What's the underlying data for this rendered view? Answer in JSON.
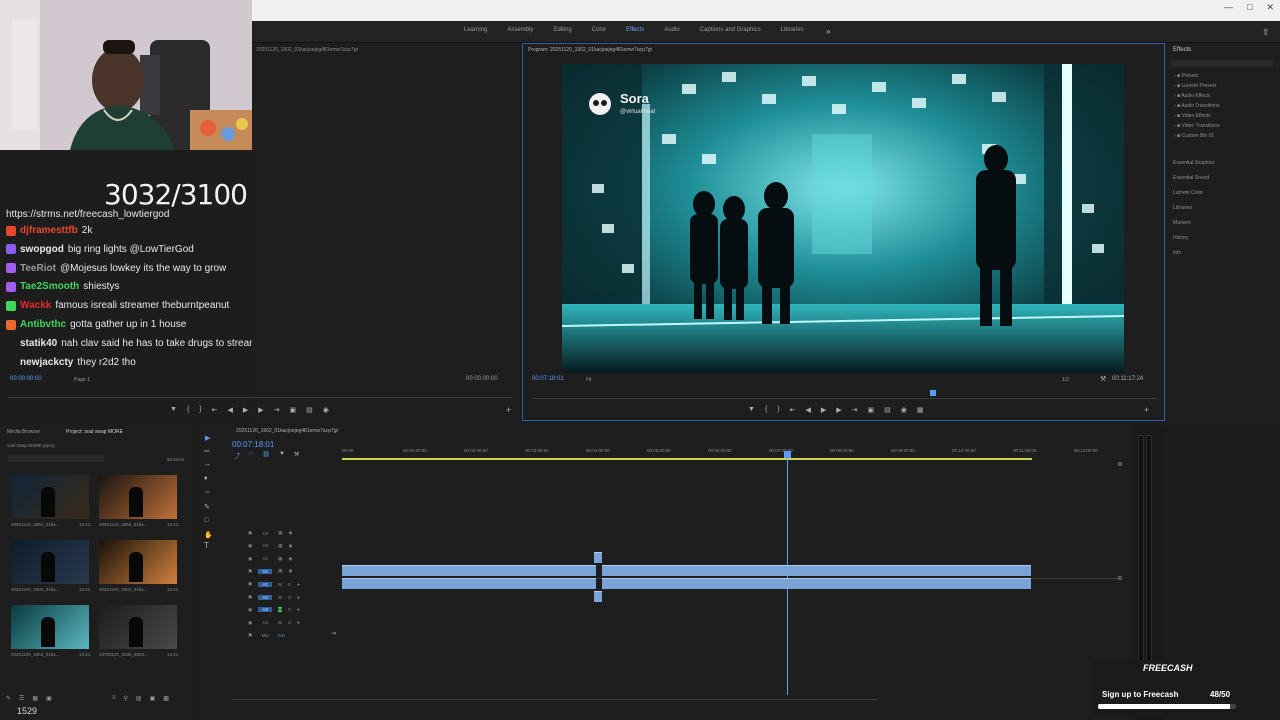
{
  "workspace_tabs": [
    "Learning",
    "Assembly",
    "Editing",
    "Color",
    "Effects",
    "Audio",
    "Captions and Graphics",
    "Libraries"
  ],
  "active_tab": "Effects",
  "stream": {
    "counter": "3032/3100",
    "link": "https://strms.net/freecash_lowtiergod",
    "chat": [
      {
        "user": "djframesttfb",
        "message": "2k",
        "color": "#e8472b"
      },
      {
        "user": "swopgod",
        "message": "big ring lights @LowTierGod",
        "color": "#e8e8e8"
      },
      {
        "user": "TeeRiot",
        "message": "@Mojesus lowkey its the way to grow",
        "color": "#9a9a9a"
      },
      {
        "user": "Tae2Smooth",
        "message": "shiestys",
        "color": "#3fd65c"
      },
      {
        "user": "Wackk",
        "message": "famous isreali streamer theburntpeanut",
        "color": "#e8272b"
      },
      {
        "user": "Antibvthc",
        "message": "gotta gather up in 1 house",
        "color": "#3fd65c"
      },
      {
        "user": "statik40",
        "message": "nah clav said he has to take drugs to stream",
        "color": "#e8e8e8"
      },
      {
        "user": "newjackcty",
        "message": "they r2d2 tho",
        "color": "#e8e8e8"
      }
    ],
    "viewer_count": "1529"
  },
  "source_monitor": {
    "title": "20251120_1902_01kacjoejeg481emw7acp7gt",
    "timecode_left": "00:00:00:00",
    "page": "Page 1",
    "timecode_right": "00:00:00:00"
  },
  "program_monitor": {
    "title": "Program: 20251120_1902_01kacjoejeg481emw7acp7gt",
    "timecode": "00:07:18:01",
    "fit": "Fit",
    "resolution": "1/2",
    "duration": "00:11:17:24",
    "watermark": "Sora",
    "watermark_handle": "@virtualmeal"
  },
  "effects_panel": {
    "title": "Effects",
    "tree": [
      "Presets",
      "Lumetri Presets",
      "Audio Effects",
      "Audio Transitions",
      "Video Effects",
      "Video Transitions",
      "Custom Bin 01"
    ],
    "sections": [
      "Essential Graphics",
      "Essential Sound",
      "Lumetri Color",
      "Libraries",
      "Markers",
      "History",
      "Info"
    ]
  },
  "project_panel": {
    "tabs": [
      "Media Browser",
      "Project: soul swap MORE"
    ],
    "path": "soul swap MORE.prproj",
    "item_count": "50 items",
    "thumbs": [
      {
        "name": "20251120_1854_01ka...",
        "duration": "14:21"
      },
      {
        "name": "20251120_1856_01ka...",
        "duration": "14:21"
      },
      {
        "name": "20251120_1900_01ka...",
        "duration": "14:21"
      },
      {
        "name": "20251120_1902_01ka...",
        "duration": "14:21"
      },
      {
        "name": "20251120_1954_01ka...",
        "duration": "14:21"
      },
      {
        "name": "19700121_0335_6920...",
        "duration": "14:21"
      }
    ]
  },
  "timeline": {
    "title": "20251120_1902_01kacjoejeg481emw7acp7gt",
    "timecode": "00:07:18:01",
    "ruler": [
      "00:00",
      "00:01:00:00",
      "00:02:00:00",
      "00:03:00:00",
      "00:04:00:00",
      "00:05:00:00",
      "00:06:00:00",
      "00:07:00:00",
      "00:08:00:00",
      "00:09:00:00",
      "00:10:00:00",
      "00:11:00:00",
      "00:12:00:00"
    ],
    "tracks": [
      "V4",
      "V3",
      "V2",
      "V1",
      "A1",
      "A2",
      "A3",
      "A4",
      "Mix"
    ],
    "mix_value": "0.0"
  },
  "freecash": {
    "brand": "FREECASH",
    "label": "Sign up to Freecash",
    "count": "48/50",
    "progress": 0.96
  },
  "colors": {
    "accent": "#5b9bff",
    "workbar": "#c9d24a",
    "clip": "#7aa3d6"
  }
}
